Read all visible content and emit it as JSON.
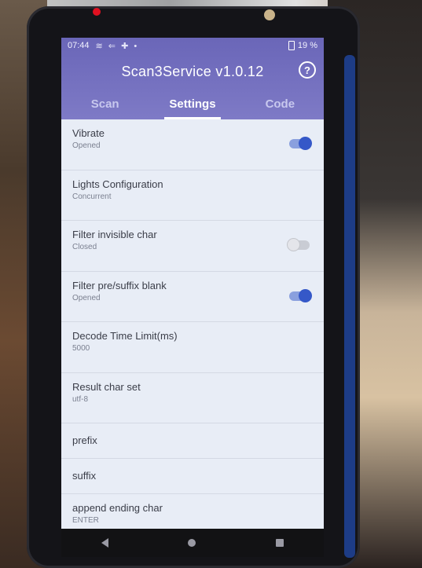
{
  "status_bar": {
    "time": "07:44",
    "icons": "≋ ⇐ ✚ •",
    "battery": "19 %"
  },
  "app": {
    "title": "Scan3Service v1.0.12",
    "help_icon": "help-circle-icon"
  },
  "tabs": [
    {
      "label": "Scan",
      "active": false
    },
    {
      "label": "Settings",
      "active": true
    },
    {
      "label": "Code",
      "active": false
    }
  ],
  "settings": [
    {
      "title": "Vibrate",
      "value": "Opened",
      "toggle": "on"
    },
    {
      "title": "Lights Configuration",
      "value": "Concurrent"
    },
    {
      "title": "Filter invisible char",
      "value": "Closed",
      "toggle": "off"
    },
    {
      "title": "Filter pre/suffix blank",
      "value": "Opened",
      "toggle": "on"
    },
    {
      "title": "Decode Time Limit(ms)",
      "value": "5000"
    },
    {
      "title": "Result char set",
      "value": "utf-8"
    },
    {
      "title": "prefix"
    },
    {
      "title": "suffix"
    },
    {
      "title": "append ending char",
      "value": "ENTER"
    }
  ],
  "colors": {
    "header": "#7470c0",
    "toggle_on": "#3558c8",
    "screen_bg": "#e8edf6"
  }
}
